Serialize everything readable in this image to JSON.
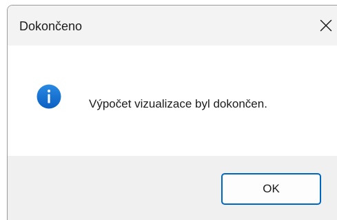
{
  "dialog": {
    "title": "Dokončeno",
    "close_icon": "close-icon",
    "message": "Výpočet vizualizace byl dokončen.",
    "message_icon": "info-icon",
    "ok_label": "OK",
    "accent_color": "#0067c0",
    "icon_color": "#1170d2"
  }
}
